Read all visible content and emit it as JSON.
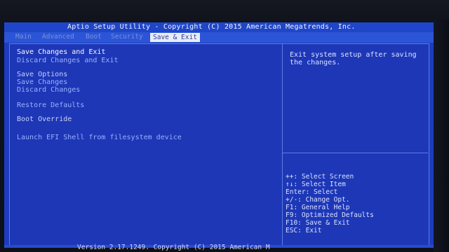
{
  "title": "Aptio Setup Utility - Copyright (C) 2015 American Megatrends, Inc.",
  "tabs": [
    {
      "label": "Main",
      "active": false
    },
    {
      "label": "Advanced",
      "active": false
    },
    {
      "label": "Boot",
      "active": false
    },
    {
      "label": "Security",
      "active": false
    },
    {
      "label": "Save & Exit",
      "active": true
    }
  ],
  "menu": {
    "items": [
      {
        "label": "Save Changes and Exit"
      },
      {
        "label": "Discard Changes and Exit"
      },
      {
        "label": "Save Options"
      },
      {
        "label": "Save Changes"
      },
      {
        "label": "Discard Changes"
      },
      {
        "label": "Restore Defaults"
      },
      {
        "label": "Boot Override"
      },
      {
        "label": "Launch EFI Shell from filesystem device"
      }
    ]
  },
  "help": {
    "text": "Exit system setup after saving the changes."
  },
  "keys": [
    "++: Select Screen",
    "↑↓: Select Item",
    "Enter: Select",
    "+/-: Change Opt.",
    "F1: General Help",
    "F9: Optimized Defaults",
    "F10: Save & Exit",
    "ESC: Exit"
  ],
  "footer": {
    "text": "Version 2.17.1249. Copyright (C) 2015 American M"
  },
  "colors": {
    "bios_blue": "#1d3cc0",
    "panel_border": "#5d7ee6",
    "active_tab_bg": "#e9ecf7"
  }
}
